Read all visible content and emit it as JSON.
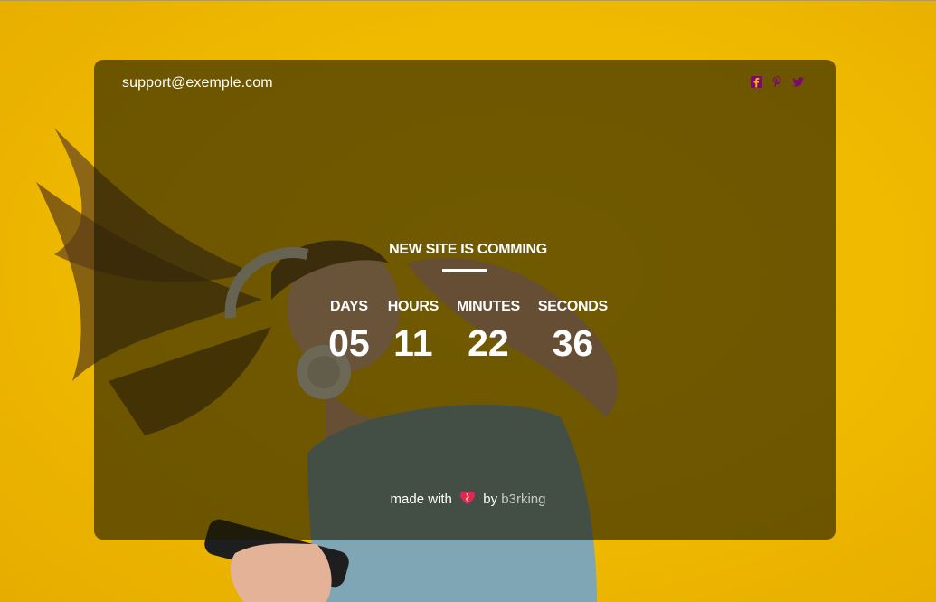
{
  "header": {
    "email": "support@exemple.com",
    "social": [
      {
        "icon": "facebook-icon",
        "color": "#7b0a6e"
      },
      {
        "icon": "pinterest-icon",
        "color": "#7b0a6e"
      },
      {
        "icon": "twitter-icon",
        "color": "#7b0a6e"
      }
    ]
  },
  "hero": {
    "headline": "NEW SITE IS COMMING"
  },
  "countdown": {
    "days_label": "DAYS",
    "days_value": "05",
    "hours_label": "HOURS",
    "hours_value": "11",
    "minutes_label": "MINUTES",
    "minutes_value": "22",
    "seconds_label": "SECONDS",
    "seconds_value": "36"
  },
  "footer": {
    "made_with": "made with",
    "by": "by",
    "author": "b3rking",
    "heart_icon": "heart-icon"
  },
  "colors": {
    "background": "#f0ba00",
    "overlay": "rgba(30,26,0,0.62)",
    "text": "#ffffff",
    "author_link": "#c9c9c9",
    "social_icon": "#7b0a6e"
  }
}
